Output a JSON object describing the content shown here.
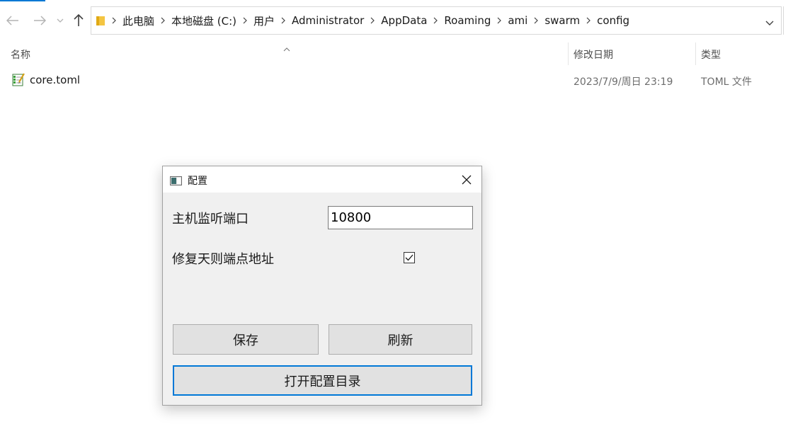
{
  "address_bar": {
    "breadcrumbs": [
      "此电脑",
      "本地磁盘 (C:)",
      "用户",
      "Administrator",
      "AppData",
      "Roaming",
      "ami",
      "swarm",
      "config"
    ]
  },
  "columns": {
    "name": "名称",
    "modified": "修改日期",
    "type": "类型"
  },
  "files": [
    {
      "name": "core.toml",
      "modified": "2023/7/9/周日 23:19",
      "type": "TOML 文件"
    }
  ],
  "dialog": {
    "title": "配置",
    "port_label": "主机监听端口",
    "port_value": "10800",
    "fix_label": "修复天则端点地址",
    "fix_checked": true,
    "save_label": "保存",
    "refresh_label": "刷新",
    "open_dir_label": "打开配置目录"
  },
  "colors": {
    "accent": "#0078d4",
    "dialog_bg": "#f0f0f0",
    "button_bg": "#e1e1e1"
  }
}
